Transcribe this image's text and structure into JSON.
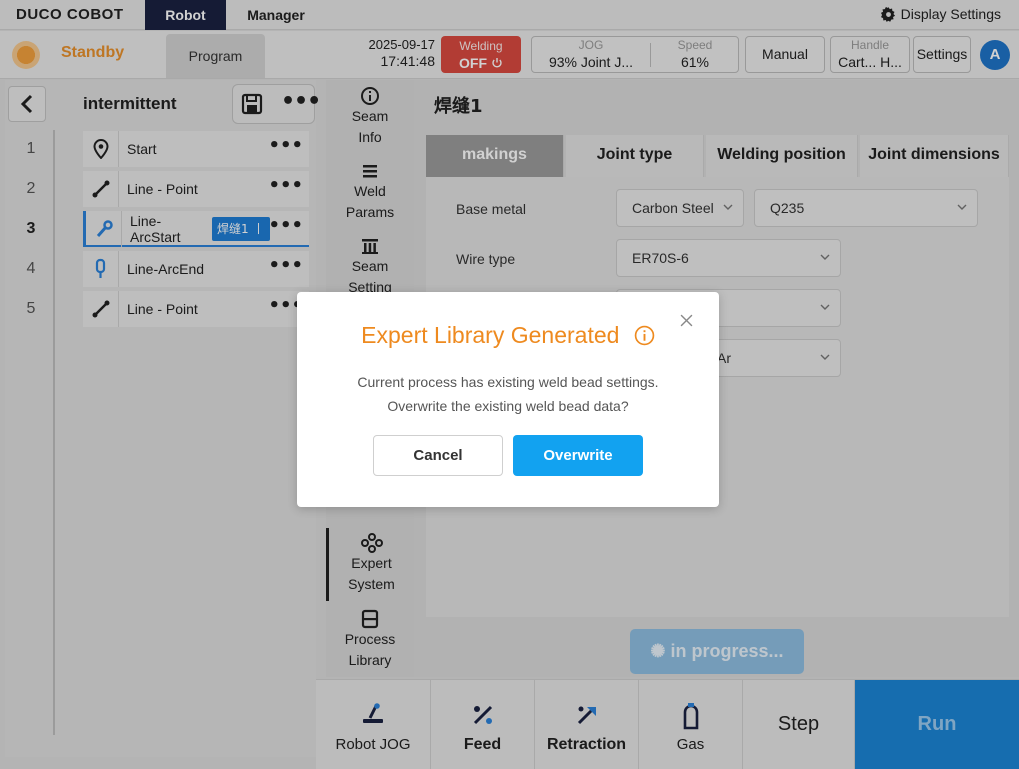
{
  "topbar": {
    "logo": "DUCO COBOT",
    "nav": [
      "Robot",
      "Manager"
    ],
    "display_settings": "Display Settings"
  },
  "status": {
    "state": "Standby",
    "program_tab": "Program",
    "date": "2025-09-17",
    "time": "17:41:48",
    "welding_label": "Welding",
    "welding_state": "OFF",
    "jog_label": "JOG",
    "jog_value": "93%  Joint J...",
    "speed_label": "Speed",
    "speed_value": "61%",
    "manual": "Manual",
    "handle_label": "Handle",
    "handle_value": "Cart...  H...",
    "settings": "Settings",
    "avatar": "A"
  },
  "program": {
    "name": "intermittent",
    "lines": [
      "1",
      "2",
      "3",
      "4",
      "5"
    ],
    "commands": [
      {
        "label": "Start",
        "icon": "location-pin-icon"
      },
      {
        "label": "Line - Point",
        "icon": "line-icon"
      },
      {
        "label": "Line-\nArcStart",
        "icon": "arc-start-icon",
        "badge": "焊缝1 丨"
      },
      {
        "label": "Line-ArcEnd",
        "icon": "arc-end-icon"
      },
      {
        "label": "Line - Point",
        "icon": "line-icon"
      }
    ],
    "active_line": "3"
  },
  "midnav": {
    "items": [
      {
        "l1": "Seam",
        "l2": "Info",
        "icon": "info-icon"
      },
      {
        "l1": "Weld",
        "l2": "Params",
        "icon": "list-icon"
      },
      {
        "l1": "Seam",
        "l2": "Setting",
        "icon": "grid-icon"
      },
      {
        "l1": "Expert",
        "l2": "System",
        "icon": "expert-icon"
      },
      {
        "l1": "Process",
        "l2": "Library",
        "icon": "library-icon"
      }
    ]
  },
  "content": {
    "seam_title": "焊缝1",
    "tabs": [
      "makings",
      "Joint type",
      "Welding position",
      "Joint dimensions"
    ],
    "form": {
      "base_metal_label": "Base metal",
      "base_metal_value": "Carbon Steel",
      "base_metal_grade": "Q235",
      "wire_type_label": "Wire type",
      "wire_type_value": "ER70S-6",
      "gas_value_partial": "Ar"
    },
    "progress": "in progress..."
  },
  "bottombar": {
    "robot_jog": "Robot JOG",
    "feed": "Feed",
    "retraction": "Retraction",
    "gas": "Gas",
    "step": "Step",
    "run": "Run"
  },
  "modal": {
    "title": "Expert Library Generated",
    "line1": "Current process has existing weld bead settings.",
    "line2": "Overwrite the existing weld bead data?",
    "cancel": "Cancel",
    "overwrite": "Overwrite"
  },
  "colors": {
    "accent": "#12a2f0",
    "warning": "#ee8a1f",
    "welding_off": "#d94a40",
    "nav_active": "#1a2141"
  }
}
